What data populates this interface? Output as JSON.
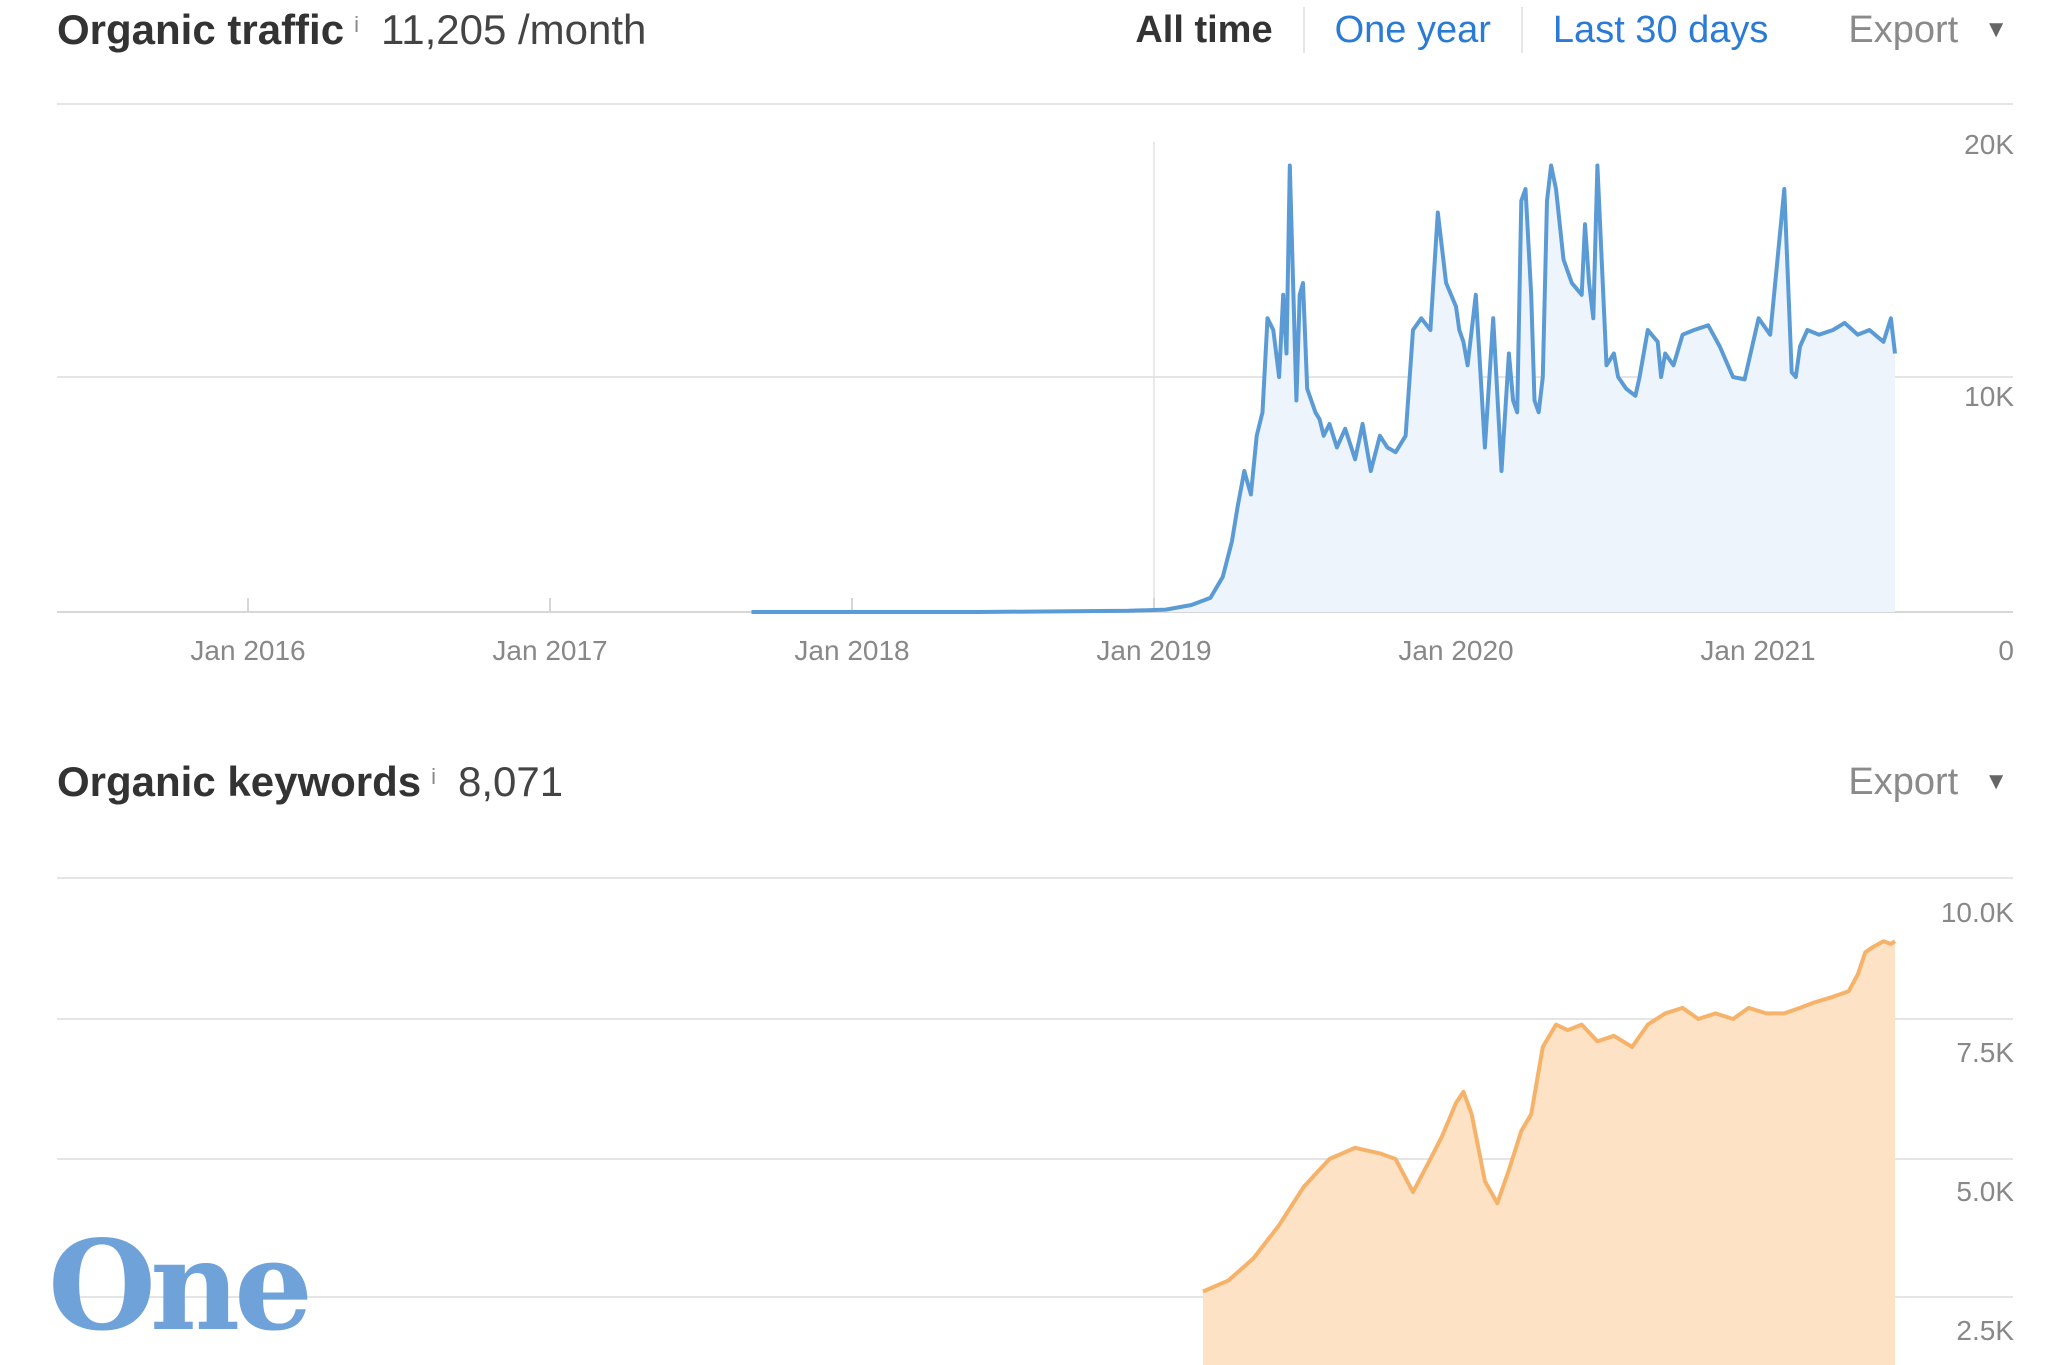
{
  "traffic": {
    "title": "Organic traffic",
    "info": "i",
    "value": "11,205 /month",
    "ranges": [
      "All time",
      "One year",
      "Last 30 days"
    ],
    "export_label": "Export",
    "caret": "▼"
  },
  "keywords": {
    "title": "Organic keywords",
    "info": "i",
    "value": "8,071",
    "export_label": "Export",
    "caret": "▼"
  },
  "logo_text": "One",
  "colors": {
    "traffic_line": "#5b9bd5",
    "traffic_fill": "#eef4fc",
    "keywords_line": "#f7b26a",
    "keywords_fill": "#fde2c6",
    "link": "#2a7ad6",
    "logo": "#6fa2d9"
  },
  "chart_data": [
    {
      "type": "area",
      "x_ticks": [
        "Jan 2016",
        "Jan 2017",
        "Jan 2018",
        "Jan 2019",
        "Jan 2020",
        "Jan 2021"
      ],
      "y_ticks": [
        "20K",
        "10K",
        "0"
      ],
      "ylim": [
        0,
        20000
      ],
      "grid": true,
      "series": [
        {
          "x": [
            "2017-09-01",
            "2018-06-01",
            "2018-12-01",
            "2019-01-15",
            "2019-02-15",
            "2019-03-10",
            "2019-03-25",
            "2019-04-05",
            "2019-04-12",
            "2019-04-20",
            "2019-04-28",
            "2019-05-05",
            "2019-05-12",
            "2019-05-18",
            "2019-05-25",
            "2019-06-01",
            "2019-06-06",
            "2019-06-10",
            "2019-06-14",
            "2019-06-18",
            "2019-06-22",
            "2019-06-26",
            "2019-06-30",
            "2019-07-05",
            "2019-07-10",
            "2019-07-15",
            "2019-07-20",
            "2019-07-25",
            "2019-08-01",
            "2019-08-10",
            "2019-08-20",
            "2019-09-01",
            "2019-09-10",
            "2019-09-20",
            "2019-10-01",
            "2019-10-10",
            "2019-10-20",
            "2019-11-01",
            "2019-11-10",
            "2019-11-20",
            "2019-12-01",
            "2019-12-10",
            "2019-12-20",
            "2020-01-01",
            "2020-01-05",
            "2020-01-10",
            "2020-01-15",
            "2020-01-25",
            "2020-02-05",
            "2020-02-15",
            "2020-02-25",
            "2020-03-05",
            "2020-03-10",
            "2020-03-15",
            "2020-03-20",
            "2020-03-25",
            "2020-04-01",
            "2020-04-05",
            "2020-04-10",
            "2020-04-15",
            "2020-04-20",
            "2020-04-25",
            "2020-05-01",
            "2020-05-10",
            "2020-05-20",
            "2020-06-01",
            "2020-06-05",
            "2020-06-10",
            "2020-06-15",
            "2020-06-20",
            "2020-07-01",
            "2020-07-10",
            "2020-07-15",
            "2020-07-25",
            "2020-08-05",
            "2020-08-10",
            "2020-08-20",
            "2020-09-01",
            "2020-09-05",
            "2020-09-10",
            "2020-09-20",
            "2020-10-01",
            "2020-10-15",
            "2020-11-01",
            "2020-11-15",
            "2020-12-01",
            "2020-12-15",
            "2021-01-01",
            "2021-01-15",
            "2021-02-01",
            "2021-02-10",
            "2021-02-15",
            "2021-02-20",
            "2021-03-01",
            "2021-03-15",
            "2021-04-01",
            "2021-04-15",
            "2021-05-01",
            "2021-05-15",
            "2021-06-01",
            "2021-06-10",
            "2021-06-15"
          ],
          "y": [
            0,
            0,
            50,
            100,
            300,
            600,
            1500,
            3000,
            4500,
            6000,
            5000,
            7500,
            8500,
            12500,
            12000,
            10000,
            13500,
            11000,
            19000,
            14000,
            9000,
            13500,
            14000,
            9500,
            9000,
            8500,
            8200,
            7500,
            8000,
            7000,
            7800,
            6500,
            8000,
            6000,
            7500,
            7000,
            6800,
            7500,
            12000,
            12500,
            12000,
            17000,
            14000,
            13000,
            12000,
            11500,
            10500,
            13500,
            7000,
            12500,
            6000,
            11000,
            9000,
            8500,
            17500,
            18000,
            13500,
            9000,
            8500,
            10000,
            17500,
            19000,
            18000,
            15000,
            14000,
            13500,
            16500,
            14000,
            12500,
            19000,
            10500,
            11000,
            10000,
            9500,
            9200,
            10000,
            12000,
            11500,
            10000,
            11000,
            10500,
            11800,
            12000,
            12200,
            11300,
            10000,
            9900,
            12500,
            11800,
            18000,
            10200,
            10000,
            11300,
            12000,
            11800,
            12000,
            12300,
            11800,
            12000,
            11500,
            12500,
            11000
          ]
        }
      ],
      "cursor_line": "Jan 2019"
    },
    {
      "type": "area",
      "y_ticks": [
        "10.0K",
        "7.5K",
        "5.0K",
        "2.5K"
      ],
      "ylim": [
        2500,
        10000
      ],
      "grid": true,
      "series": [
        {
          "x": [
            "2019-03-01",
            "2019-04-01",
            "2019-05-01",
            "2019-06-01",
            "2019-07-01",
            "2019-08-01",
            "2019-09-01",
            "2019-10-01",
            "2019-10-20",
            "2019-11-10",
            "2019-12-01",
            "2019-12-15",
            "2020-01-01",
            "2020-01-10",
            "2020-01-20",
            "2020-02-05",
            "2020-02-20",
            "2020-03-05",
            "2020-03-20",
            "2020-04-01",
            "2020-04-15",
            "2020-05-01",
            "2020-05-15",
            "2020-06-01",
            "2020-06-20",
            "2020-07-10",
            "2020-08-01",
            "2020-08-20",
            "2020-09-10",
            "2020-10-01",
            "2020-10-20",
            "2020-11-10",
            "2020-12-01",
            "2020-12-20",
            "2021-01-10",
            "2021-02-01",
            "2021-02-20",
            "2021-03-10",
            "2021-04-01",
            "2021-04-20",
            "2021-05-01",
            "2021-05-10",
            "2021-05-20",
            "2021-06-01",
            "2021-06-10",
            "2021-06-15"
          ],
          "y": [
            2600,
            2800,
            3200,
            3800,
            4500,
            5000,
            5200,
            5100,
            5000,
            4400,
            5000,
            5400,
            6000,
            6200,
            5800,
            4600,
            4200,
            4800,
            5500,
            5800,
            7000,
            7400,
            7300,
            7400,
            7100,
            7200,
            7000,
            7400,
            7600,
            7700,
            7500,
            7600,
            7500,
            7700,
            7600,
            7600,
            7700,
            7800,
            7900,
            8000,
            8300,
            8700,
            8800,
            8900,
            8850,
            8900
          ]
        }
      ]
    }
  ]
}
